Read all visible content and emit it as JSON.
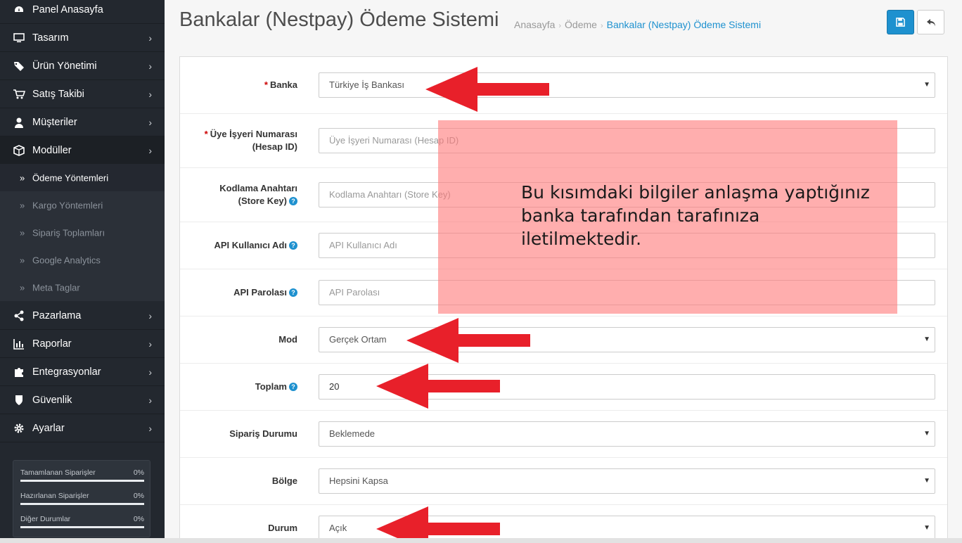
{
  "sidebar": {
    "items": [
      {
        "label": "Panel Anasayfa",
        "icon": "dashboard-icon"
      },
      {
        "label": "Tasarım",
        "icon": "monitor-icon"
      },
      {
        "label": "Ürün Yönetimi",
        "icon": "tags-icon"
      },
      {
        "label": "Satış Takibi",
        "icon": "cart-icon"
      },
      {
        "label": "Müşteriler",
        "icon": "user-icon"
      },
      {
        "label": "Modüller",
        "icon": "cube-icon"
      },
      {
        "label": "Pazarlama",
        "icon": "share-icon"
      },
      {
        "label": "Raporlar",
        "icon": "bar-chart-icon"
      },
      {
        "label": "Entegrasyonlar",
        "icon": "puzzle-icon"
      },
      {
        "label": "Güvenlik",
        "icon": "shield-icon"
      },
      {
        "label": "Ayarlar",
        "icon": "gear-icon"
      }
    ],
    "subitems": [
      {
        "label": "Ödeme Yöntemleri"
      },
      {
        "label": "Kargo Yöntemleri"
      },
      {
        "label": "Sipariş Toplamları"
      },
      {
        "label": "Google Analytics"
      },
      {
        "label": "Meta Taglar"
      }
    ],
    "stats": [
      {
        "label": "Tamamlanan Siparişler",
        "value": "0%"
      },
      {
        "label": "Hazırlanan Siparişler",
        "value": "0%"
      },
      {
        "label": "Diğer Durumlar",
        "value": "0%"
      }
    ]
  },
  "header": {
    "title": "Bankalar (Nestpay) Ödeme Sistemi",
    "breadcrumb": [
      "Anasayfa",
      "Ödeme",
      "Bankalar (Nestpay) Ödeme Sistemi"
    ]
  },
  "form": {
    "fields": [
      {
        "label": "Banka",
        "required": true,
        "type": "select",
        "value": "Türkiye İş Bankası"
      },
      {
        "label": "Üye İşyeri Numarası",
        "label2": "(Hesap ID)",
        "required": true,
        "type": "input",
        "placeholder": "Üye İşyeri Numarası (Hesap ID)"
      },
      {
        "label": "Kodlama Anahtarı",
        "label2": "(Store Key)",
        "help": true,
        "type": "input",
        "placeholder": "Kodlama Anahtarı (Store Key)"
      },
      {
        "label": "API Kullanıcı Adı",
        "help": true,
        "type": "input",
        "placeholder": "API Kullanıcı Adı"
      },
      {
        "label": "API Parolası",
        "help": true,
        "type": "input",
        "placeholder": "API Parolası"
      },
      {
        "label": "Mod",
        "type": "select",
        "value": "Gerçek Ortam"
      },
      {
        "label": "Toplam",
        "help": true,
        "type": "input",
        "value": "20"
      },
      {
        "label": "Sipariş Durumu",
        "type": "select",
        "value": "Beklemede"
      },
      {
        "label": "Bölge",
        "type": "select",
        "value": "Hepsini Kapsa"
      },
      {
        "label": "Durum",
        "type": "select",
        "value": "Açık"
      }
    ]
  },
  "annotation": {
    "text": "Bu kısımdaki bilgiler anlaşma yaptığınız banka tarafından tarafınıza iletilmektedir.",
    "arrow_color": "#e8202a",
    "box_color": "#ff7878"
  },
  "colors": {
    "accent": "#1e91cf",
    "sidebar_bg": "#23282f",
    "required": "#cc0000"
  }
}
